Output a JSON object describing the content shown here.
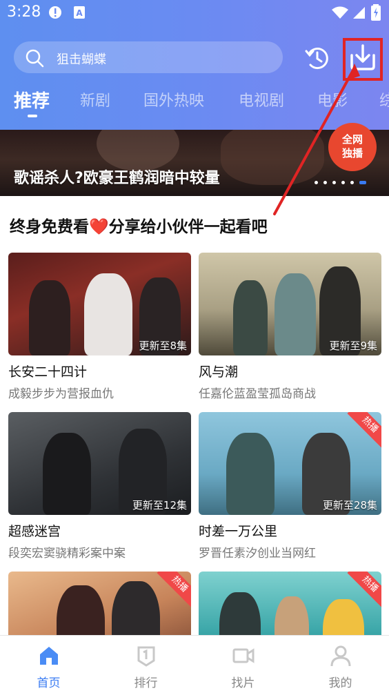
{
  "status_bar": {
    "time": "3:28"
  },
  "search": {
    "placeholder": "狙击蝴蝶"
  },
  "header_buttons": {
    "history": "history-icon",
    "download": "download-icon"
  },
  "tabs": [
    {
      "label": "推荐",
      "active": true
    },
    {
      "label": "新剧",
      "active": false
    },
    {
      "label": "国外热映",
      "active": false
    },
    {
      "label": "电视剧",
      "active": false
    },
    {
      "label": "电影",
      "active": false
    },
    {
      "label": "综",
      "active": false
    }
  ],
  "banner": {
    "title": "歌谣杀人?欧豪王鹤润暗中较量",
    "badge_line1": "全网",
    "badge_line2": "独播",
    "slide_count": 6,
    "active_slide": 6
  },
  "section": {
    "title": "终身免费看❤️分享给小伙伴一起看吧"
  },
  "cards": [
    {
      "title": "长安二十四计",
      "subtitle": "成毅步步为营报血仇",
      "episodes": "更新至8集",
      "hot": false
    },
    {
      "title": "风与潮",
      "subtitle": "任嘉伦蓝盈莹孤岛商战",
      "episodes": "更新至9集",
      "hot": false
    },
    {
      "title": "超感迷宫",
      "subtitle": "段奕宏窦骁精彩案中案",
      "episodes": "更新至12集",
      "hot": false
    },
    {
      "title": "时差一万公里",
      "subtitle": "罗晋任素汐创业当网红",
      "episodes": "更新至28集",
      "hot": true,
      "hot_label": "热播"
    },
    {
      "title": "",
      "subtitle": "",
      "episodes": "",
      "hot": true,
      "hot_label": "热播"
    },
    {
      "title": "",
      "subtitle": "",
      "episodes": "",
      "hot": true,
      "hot_label": "热播"
    }
  ],
  "bottom_nav": [
    {
      "label": "首页",
      "icon": "home-icon",
      "active": true
    },
    {
      "label": "排行",
      "icon": "ranking-icon",
      "active": false
    },
    {
      "label": "找片",
      "icon": "video-camera-icon",
      "active": false
    },
    {
      "label": "我的",
      "icon": "user-icon",
      "active": false
    }
  ],
  "colors": {
    "accent": "#3a7bf2",
    "hot": "#f04848",
    "annotation": "#e02424"
  }
}
